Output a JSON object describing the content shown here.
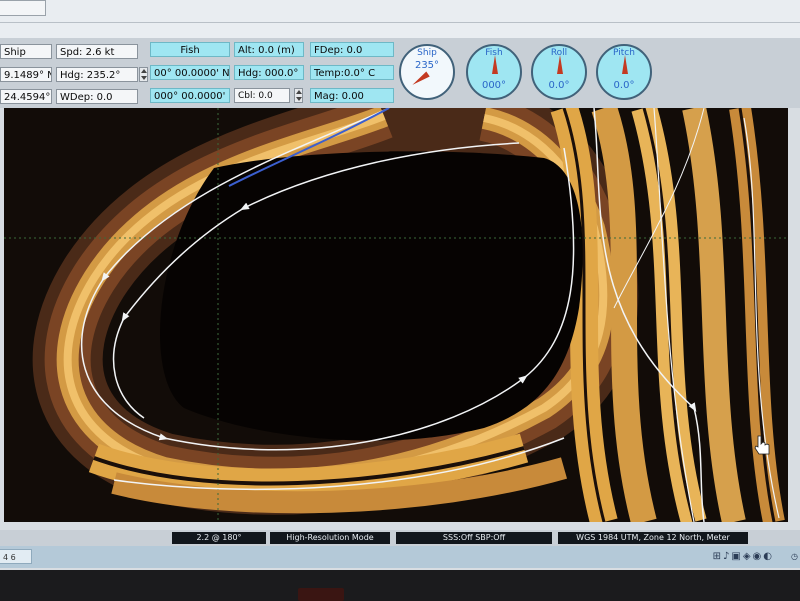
{
  "toolbar": {
    "ship_label": "Ship",
    "speed": "Spd: 2.6 kt",
    "ship_lat": "9.1489° N",
    "ship_heading": "Hdg: 235.2°",
    "ship_lon": "24.4594° W",
    "water_depth": "WDep: 0.0",
    "fish_label": "Fish",
    "fish_lat": "00° 00.0000' N",
    "fish_lon": "000° 00.0000' E",
    "altitude": "Alt: 0.0 (m)",
    "fish_heading": "Hdg: 000.0°",
    "cable": "Cbl: 0.0",
    "fish_depth": "FDep: 0.0",
    "temperature": "Temp:0.0° C",
    "mag": "Mag: 0.00"
  },
  "gauges": [
    {
      "label": "Ship",
      "value": "235°",
      "angle": 235
    },
    {
      "label": "Fish",
      "value": "000°",
      "angle": 0
    },
    {
      "label": "Roll",
      "value": "0.0°",
      "angle": 0
    },
    {
      "label": "Pitch",
      "value": "0.0°",
      "angle": 0
    }
  ],
  "status": {
    "range": "2.2 @ 180°",
    "mode": "High-Resolution Mode",
    "sss_sbp": "SSS:Off    SBP:Off",
    "projection": "WGS 1984 UTM, Zone 12 North, Meter"
  },
  "taskbar": {
    "window_label": "4 6"
  },
  "colors": {
    "map_background": "#120c08",
    "swath": "#e0a646",
    "track": "#f2f4f6",
    "field_cyan": "#9fe6f2",
    "needle": "#c43a22"
  }
}
